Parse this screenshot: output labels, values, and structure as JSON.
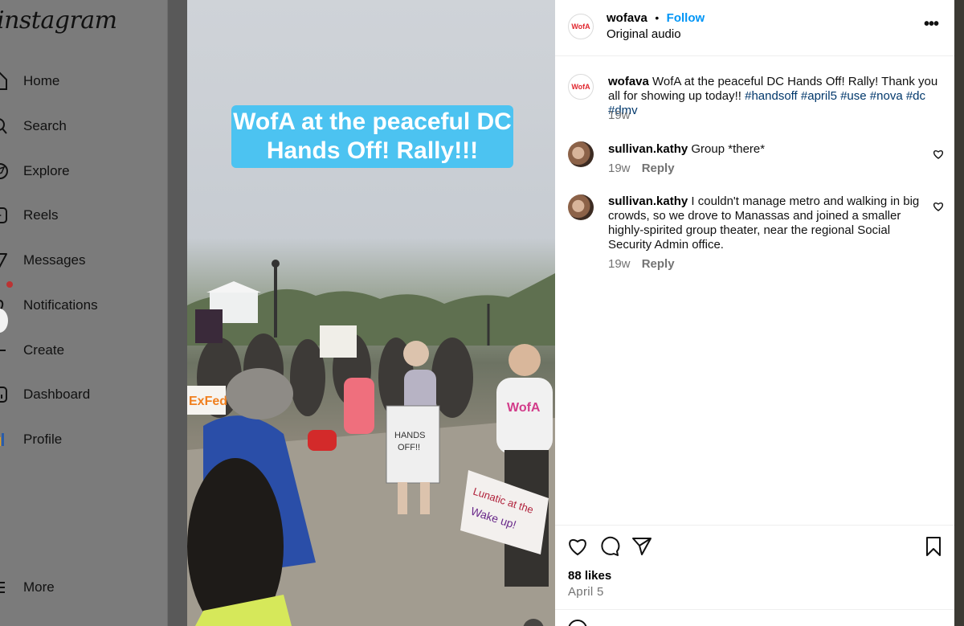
{
  "sidebar": {
    "logo": "Instagram",
    "items": [
      {
        "label": "Home",
        "icon": "home-icon"
      },
      {
        "label": "Search",
        "icon": "search-icon"
      },
      {
        "label": "Explore",
        "icon": "compass-icon"
      },
      {
        "label": "Reels",
        "icon": "reels-icon"
      },
      {
        "label": "Messages",
        "icon": "paper-plane-icon"
      },
      {
        "label": "Notifications",
        "icon": "heart-icon"
      },
      {
        "label": "Create",
        "icon": "plus-icon"
      },
      {
        "label": "Dashboard",
        "icon": "chart-icon"
      },
      {
        "label": "Profile",
        "icon": "avatar-icon"
      },
      {
        "label": "More",
        "icon": "menu-icon"
      }
    ]
  },
  "video": {
    "caption_line1": "WofA at the peaceful DC",
    "caption_line2": "Hands Off! Rally!!!"
  },
  "post": {
    "author": "wofava",
    "avatar_text": "WofA",
    "separator": "•",
    "follow_label": "Follow",
    "audio": "Original audio",
    "caption": {
      "user": "wofava",
      "text": "WofA at the peaceful DC Hands Off! Rally! Thank you all for showing up today!!",
      "hashtags": "#handsoff #april5 #use #nova #dc #dmv",
      "time": "19w"
    },
    "comments": [
      {
        "user": "sullivan.kathy",
        "text": "Group *there*",
        "time": "19w",
        "reply_label": "Reply"
      },
      {
        "user": "sullivan.kathy",
        "text": "I couldn't manage metro and walking in big crowds, so we drove to Manassas and joined a smaller highly-spirited group theater, near the regional Social Security Admin office.",
        "time": "19w",
        "reply_label": "Reply"
      }
    ],
    "likes": "88 likes",
    "date": "April 5"
  },
  "colors": {
    "follow_blue": "#0095f6",
    "hashtag_blue": "#00376b",
    "caption_bg": "#4cc3f1",
    "wofa_red": "#e0262e"
  }
}
